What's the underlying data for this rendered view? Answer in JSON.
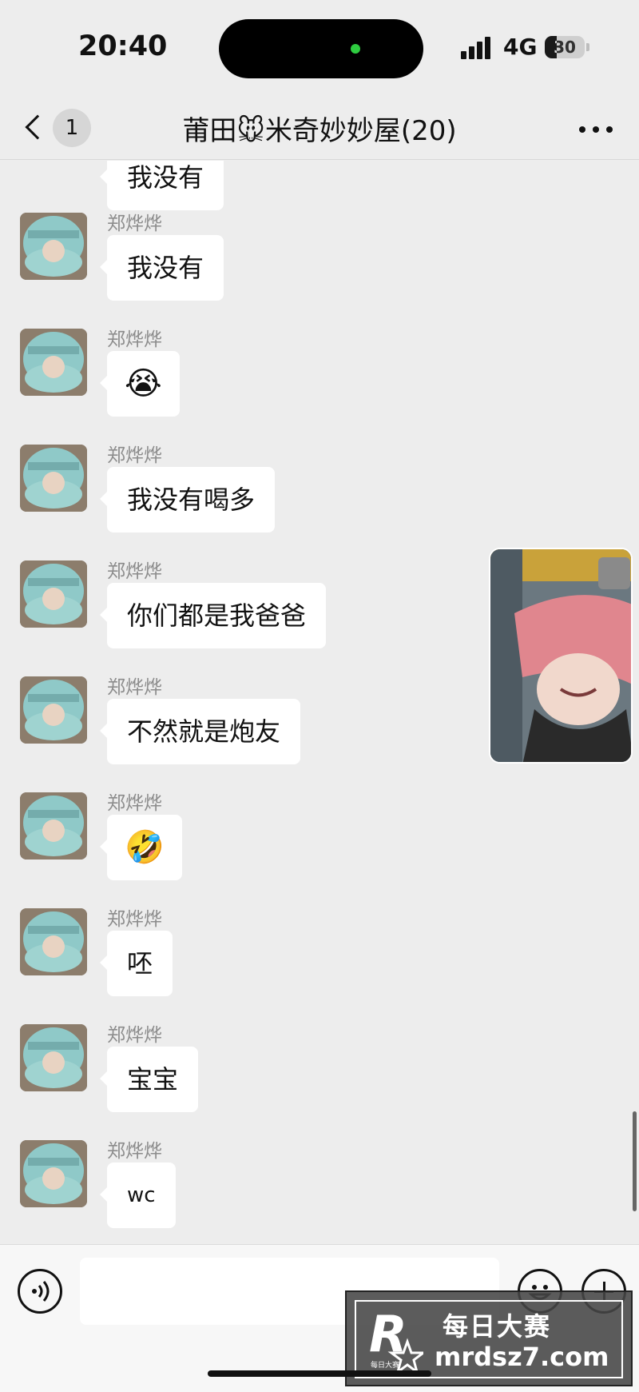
{
  "status_bar": {
    "time": "20:40",
    "network": "4G",
    "battery": "30",
    "battery_level": 0.3
  },
  "nav": {
    "unread_count": "1",
    "title": "莆田🐭米奇妙妙屋(20)"
  },
  "messages": [
    {
      "sender": "",
      "text": "我没有",
      "kind": "text"
    },
    {
      "sender": "郑烨烨",
      "text": "我没有",
      "kind": "text"
    },
    {
      "sender": "郑烨烨",
      "text": "😭",
      "kind": "emoji"
    },
    {
      "sender": "郑烨烨",
      "text": "我没有喝多",
      "kind": "text"
    },
    {
      "sender": "郑烨烨",
      "text": "你们都是我爸爸",
      "kind": "text"
    },
    {
      "sender": "郑烨烨",
      "text": "不然就是炮友",
      "kind": "text"
    },
    {
      "sender": "郑烨烨",
      "text": "🤣",
      "kind": "emoji"
    },
    {
      "sender": "郑烨烨",
      "text": "呸",
      "kind": "text"
    },
    {
      "sender": "郑烨烨",
      "text": "宝宝",
      "kind": "text"
    },
    {
      "sender": "郑烨烨",
      "text": "wc",
      "kind": "small"
    }
  ],
  "watermark": {
    "logo_letter": "R",
    "logo_caption": "每日大赛",
    "title": "每日大赛",
    "url": "mrdsz7.com"
  },
  "icons": {
    "voice": "voice-icon",
    "emoji": "emoji-icon",
    "plus": "plus-icon",
    "back": "chevron-left-icon",
    "more": "more-icon"
  }
}
